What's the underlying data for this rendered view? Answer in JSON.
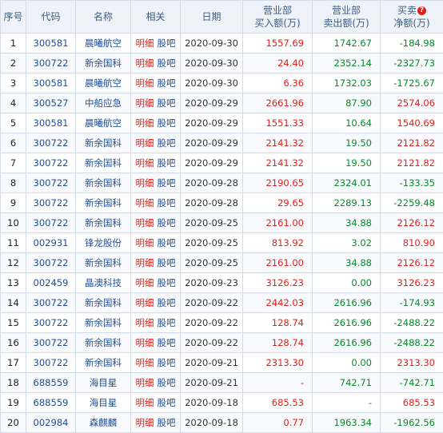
{
  "headers": {
    "idx": "序号",
    "code": "代码",
    "name": "名称",
    "related": "相关",
    "date": "日期",
    "buy_line1": "营业部",
    "buy_line2": "买入额(万)",
    "sell_line1": "营业部",
    "sell_line2": "卖出额(万)",
    "net_line1": "买卖",
    "net_line2": "净额(万)",
    "help_icon_glyph": "?"
  },
  "related_links": {
    "detail": "明细",
    "forum": "股吧"
  },
  "colors": {
    "up": "#e0211a",
    "down": "#0a8a2a",
    "link": "#1f4e96"
  },
  "rows": [
    {
      "idx": "1",
      "code": "300581",
      "name": "晨曦航空",
      "date": "2020-09-30",
      "buy": "1557.69",
      "sell": "1742.67",
      "net": "-184.98",
      "net_sign": "neg"
    },
    {
      "idx": "2",
      "code": "300722",
      "name": "新余国科",
      "date": "2020-09-30",
      "buy": "24.40",
      "sell": "2352.14",
      "net": "-2327.73",
      "net_sign": "neg"
    },
    {
      "idx": "3",
      "code": "300581",
      "name": "晨曦航空",
      "date": "2020-09-30",
      "buy": "6.36",
      "sell": "1732.03",
      "net": "-1725.67",
      "net_sign": "neg"
    },
    {
      "idx": "4",
      "code": "300527",
      "name": "中船应急",
      "date": "2020-09-29",
      "buy": "2661.96",
      "sell": "87.90",
      "net": "2574.06",
      "net_sign": "pos"
    },
    {
      "idx": "5",
      "code": "300581",
      "name": "晨曦航空",
      "date": "2020-09-29",
      "buy": "1551.33",
      "sell": "10.64",
      "net": "1540.69",
      "net_sign": "pos"
    },
    {
      "idx": "6",
      "code": "300722",
      "name": "新余国科",
      "date": "2020-09-29",
      "buy": "2141.32",
      "sell": "19.50",
      "net": "2121.82",
      "net_sign": "pos"
    },
    {
      "idx": "7",
      "code": "300722",
      "name": "新余国科",
      "date": "2020-09-29",
      "buy": "2141.32",
      "sell": "19.50",
      "net": "2121.82",
      "net_sign": "pos"
    },
    {
      "idx": "8",
      "code": "300722",
      "name": "新余国科",
      "date": "2020-09-28",
      "buy": "2190.65",
      "sell": "2324.01",
      "net": "-133.35",
      "net_sign": "neg"
    },
    {
      "idx": "9",
      "code": "300722",
      "name": "新余国科",
      "date": "2020-09-28",
      "buy": "29.65",
      "sell": "2289.13",
      "net": "-2259.48",
      "net_sign": "neg"
    },
    {
      "idx": "10",
      "code": "300722",
      "name": "新余国科",
      "date": "2020-09-25",
      "buy": "2161.00",
      "sell": "34.88",
      "net": "2126.12",
      "net_sign": "pos"
    },
    {
      "idx": "11",
      "code": "002931",
      "name": "锋龙股份",
      "date": "2020-09-25",
      "buy": "813.92",
      "sell": "3.02",
      "net": "810.90",
      "net_sign": "pos"
    },
    {
      "idx": "12",
      "code": "300722",
      "name": "新余国科",
      "date": "2020-09-25",
      "buy": "2161.00",
      "sell": "34.88",
      "net": "2126.12",
      "net_sign": "pos"
    },
    {
      "idx": "13",
      "code": "002459",
      "name": "晶澳科技",
      "date": "2020-09-23",
      "buy": "3126.23",
      "sell": "0.00",
      "net": "3126.23",
      "net_sign": "pos"
    },
    {
      "idx": "14",
      "code": "300722",
      "name": "新余国科",
      "date": "2020-09-22",
      "buy": "2442.03",
      "sell": "2616.96",
      "net": "-174.93",
      "net_sign": "neg"
    },
    {
      "idx": "15",
      "code": "300722",
      "name": "新余国科",
      "date": "2020-09-22",
      "buy": "128.74",
      "sell": "2616.96",
      "net": "-2488.22",
      "net_sign": "neg"
    },
    {
      "idx": "16",
      "code": "300722",
      "name": "新余国科",
      "date": "2020-09-22",
      "buy": "128.74",
      "sell": "2616.96",
      "net": "-2488.22",
      "net_sign": "neg"
    },
    {
      "idx": "17",
      "code": "300722",
      "name": "新余国科",
      "date": "2020-09-21",
      "buy": "2313.30",
      "sell": "0.00",
      "net": "2313.30",
      "net_sign": "pos"
    },
    {
      "idx": "18",
      "code": "688559",
      "name": "海目星",
      "date": "2020-09-21",
      "buy": "-",
      "sell": "742.71",
      "net": "-742.71",
      "net_sign": "neg"
    },
    {
      "idx": "19",
      "code": "688559",
      "name": "海目星",
      "date": "2020-09-18",
      "buy": "685.53",
      "sell": "-",
      "net": "685.53",
      "net_sign": "pos"
    },
    {
      "idx": "20",
      "code": "002984",
      "name": "森麒麟",
      "date": "2020-09-18",
      "buy": "0.77",
      "sell": "1963.34",
      "net": "-1962.56",
      "net_sign": "neg"
    }
  ]
}
